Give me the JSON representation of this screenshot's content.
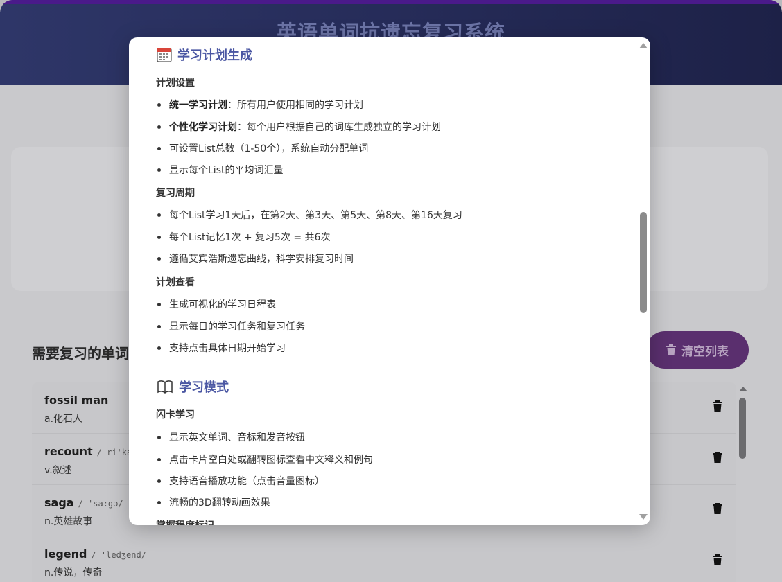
{
  "app": {
    "title": "英语单词抗遗忘复习系统"
  },
  "review": {
    "title": "需要复习的单词",
    "clear_label": "清空列表",
    "words": [
      {
        "en": "fossil man",
        "phonetic": "",
        "cn": "a.化石人"
      },
      {
        "en": "recount",
        "phonetic": "/ ri'kaunt/",
        "cn": "v.叙述"
      },
      {
        "en": "saga",
        "phonetic": "/ 'sa:gə/",
        "cn": "n.英雄故事"
      },
      {
        "en": "legend",
        "phonetic": "/ 'ledʒend/",
        "cn": "n.传说，传奇"
      }
    ]
  },
  "modal": {
    "section1": {
      "title": "学习计划生成",
      "icon": "calendar-icon",
      "groups": [
        {
          "title": "计划设置",
          "items": [
            {
              "bold": "统一学习计划",
              "text": "：所有用户使用相同的学习计划"
            },
            {
              "bold": "个性化学习计划",
              "text": "：每个用户根据自己的词库生成独立的学习计划"
            },
            {
              "bold": "",
              "text": "可设置List总数（1-50个），系统自动分配单词"
            },
            {
              "bold": "",
              "text": "显示每个List的平均词汇量"
            }
          ]
        },
        {
          "title": "复习周期",
          "items": [
            {
              "bold": "",
              "text": "每个List学习1天后，在第2天、第3天、第5天、第8天、第16天复习"
            },
            {
              "bold": "",
              "text": "每个List记忆1次 + 复习5次 = 共6次"
            },
            {
              "bold": "",
              "text": "遵循艾宾浩斯遗忘曲线，科学安排复习时间"
            }
          ]
        },
        {
          "title": "计划查看",
          "items": [
            {
              "bold": "",
              "text": "生成可视化的学习日程表"
            },
            {
              "bold": "",
              "text": "显示每日的学习任务和复习任务"
            },
            {
              "bold": "",
              "text": "支持点击具体日期开始学习"
            }
          ]
        }
      ]
    },
    "section2": {
      "title": "学习模式",
      "icon": "book-icon",
      "groups": [
        {
          "title": "闪卡学习",
          "items": [
            {
              "bold": "",
              "text": "显示英文单词、音标和发音按钮"
            },
            {
              "bold": "",
              "text": "点击卡片空白处或翻转图标查看中文释义和例句"
            },
            {
              "bold": "",
              "text": "支持语音播放功能（点击音量图标）"
            },
            {
              "bold": "",
              "text": "流畅的3D翻转动画效果"
            }
          ]
        },
        {
          "title": "掌握程度标记",
          "items": []
        }
      ]
    }
  }
}
